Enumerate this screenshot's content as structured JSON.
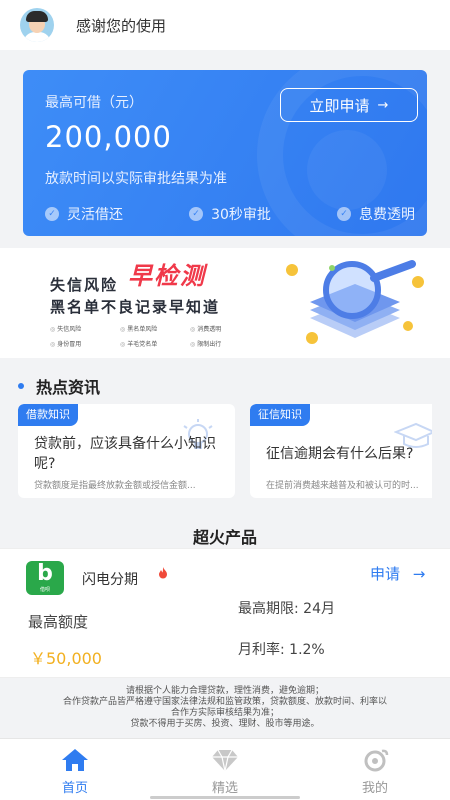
{
  "header": {
    "greeting": "感谢您的使用"
  },
  "loan_card": {
    "label": "最高可借（元）",
    "amount": "200,000",
    "note": "放款时间以实际审批结果为准",
    "apply_label": "立即申请",
    "apply_arrow": "→",
    "features": [
      "灵活借还",
      "30秒审批",
      "息费透明"
    ]
  },
  "banner": {
    "line1_part1": "失信风险",
    "line1_part2": "早检测",
    "line2": "黑名单不良记录早知道",
    "tags": [
      "失信风险",
      "黑名单风险",
      "消费透明",
      "身份冒用",
      "羊毛党名单",
      "限制出行"
    ]
  },
  "news": {
    "heading": "热点资讯",
    "items": [
      {
        "tag": "借款知识",
        "title": "贷款前，应该具备什么小知识呢?",
        "summary": "贷款额度是指最终放款金额或授信金额..."
      },
      {
        "tag": "征信知识",
        "title": "征信逾期会有什么后果?",
        "summary": "在提前消费越来越普及和被认可的时..."
      }
    ]
  },
  "products": {
    "heading": "超火产品",
    "items": [
      {
        "name": "闪电分期",
        "logo_letter": "b",
        "logo_caption": "借呗",
        "apply_label": "申请",
        "apply_arrow": "→",
        "limit_label": "最高额度",
        "limit_value": "￥50,000",
        "term": "最高期限: 24月",
        "rate": "月利率: 1.2%"
      }
    ]
  },
  "disclaimer": [
    "请根据个人能力合理贷款，理性消费，避免逾期；",
    "合作贷款产品皆严格遵守国家法律法规和监管政策，贷款额度、放款时间、利率以",
    "合作方实际审核结果为准；",
    "贷款不得用于买房、投资、理财、股市等用途。"
  ],
  "tabbar": {
    "items": [
      {
        "label": "首页",
        "icon": "home-icon",
        "active": true
      },
      {
        "label": "精选",
        "icon": "diamond-icon",
        "active": false
      },
      {
        "label": "我的",
        "icon": "profile-icon",
        "active": false
      }
    ]
  },
  "colors": {
    "primary": "#2f7cf0",
    "amount": "#f2b020",
    "danger": "#f0394a"
  }
}
